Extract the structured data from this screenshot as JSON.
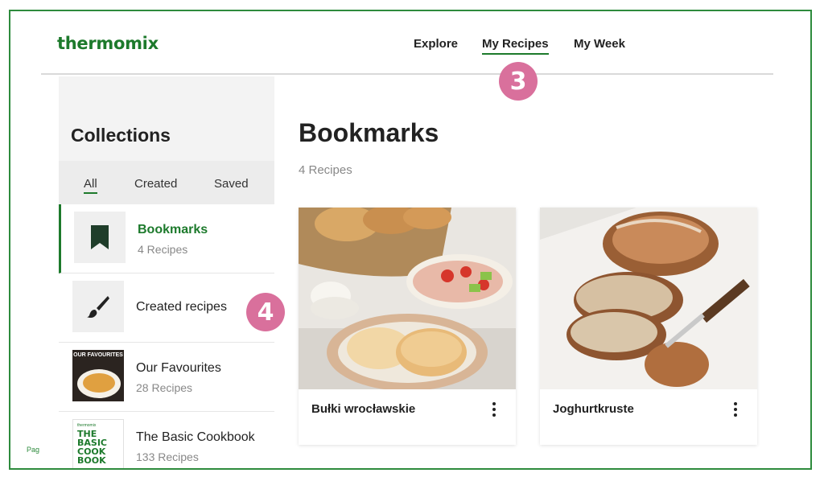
{
  "header": {
    "logo": "thermomix",
    "nav": [
      {
        "label": "Explore"
      },
      {
        "label": "My Recipes"
      },
      {
        "label": "My Week"
      }
    ]
  },
  "badges": {
    "step3": "3",
    "step4": "4"
  },
  "sidebar": {
    "title": "Collections",
    "filters": [
      {
        "label": "All"
      },
      {
        "label": "Created"
      },
      {
        "label": "Saved"
      }
    ],
    "collections": [
      {
        "name": "Bookmarks",
        "count": "4 Recipes",
        "icon": "bookmark-icon"
      },
      {
        "name": "Created recipes",
        "icon": "brush-icon"
      },
      {
        "name": "Our Favourites",
        "count": "28 Recipes",
        "thumb_text": "OUR FAVOURITES"
      },
      {
        "name": "The Basic Cookbook",
        "count": "133 Recipes",
        "thumb_text": "THE BASIC COOK BOOK",
        "thumb_brand": "thermomix"
      }
    ]
  },
  "page_label": "Pag",
  "main": {
    "title": "Bookmarks",
    "count": "4 Recipes",
    "cards": [
      {
        "name": "Bułki wrocławskie",
        "image": "bread-rolls-photo"
      },
      {
        "name": "Joghurtkruste",
        "image": "sourdough-loaf-photo"
      }
    ]
  },
  "colors": {
    "brand": "#1d7a2c",
    "badge": "#d9709c",
    "frame": "#2e8b3d"
  }
}
